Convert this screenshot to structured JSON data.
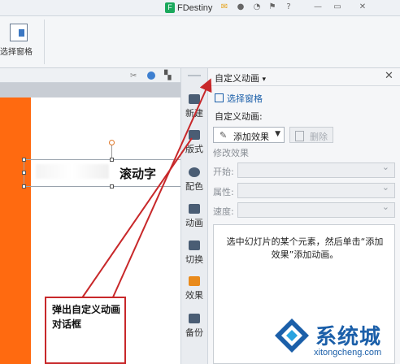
{
  "titlebar": {
    "user": "FDestiny",
    "user_initial": "F",
    "icons": [
      "mail-icon",
      "shirt-icon",
      "chat-icon",
      "pin-icon",
      "help-icon",
      "minimize-icon",
      "restore-icon",
      "close-icon"
    ],
    "help_glyph": "?",
    "minimize_glyph": "—",
    "restore_glyph": "▭",
    "close_glyph": "✕"
  },
  "ribbon": {
    "selection_pane_label": "选择窗格"
  },
  "slide": {
    "title_text": "滚动字"
  },
  "sidetabs": [
    {
      "label": "新建",
      "icon": "new-icon"
    },
    {
      "label": "版式",
      "icon": "layout-icon"
    },
    {
      "label": "配色",
      "icon": "palette-icon"
    },
    {
      "label": "动画",
      "icon": "animation-icon"
    },
    {
      "label": "切换",
      "icon": "transition-icon"
    },
    {
      "label": "效果",
      "icon": "effects-icon"
    },
    {
      "label": "备份",
      "icon": "backup-icon"
    }
  ],
  "pane": {
    "title": "自定义动画",
    "title_arrow": "▾",
    "close": "✕",
    "selection_pane": "选择窗格",
    "custom_anim_label": "自定义动画:",
    "add_effect": "添加效果",
    "delete": "删除",
    "modify_effect": "修改效果",
    "start_label": "开始:",
    "property_label": "属性:",
    "speed_label": "速度:",
    "info": "选中幻灯片的某个元素，然后单击“添加效果”添加动画。"
  },
  "annotation": {
    "text": "弹出自定义动画对话框"
  },
  "watermark": {
    "brand": "系统城",
    "url": "xitongcheng.com"
  },
  "colors": {
    "accent": "#c8282a",
    "slide_orange": "#ff6a10",
    "link_blue": "#1b5fa9"
  }
}
